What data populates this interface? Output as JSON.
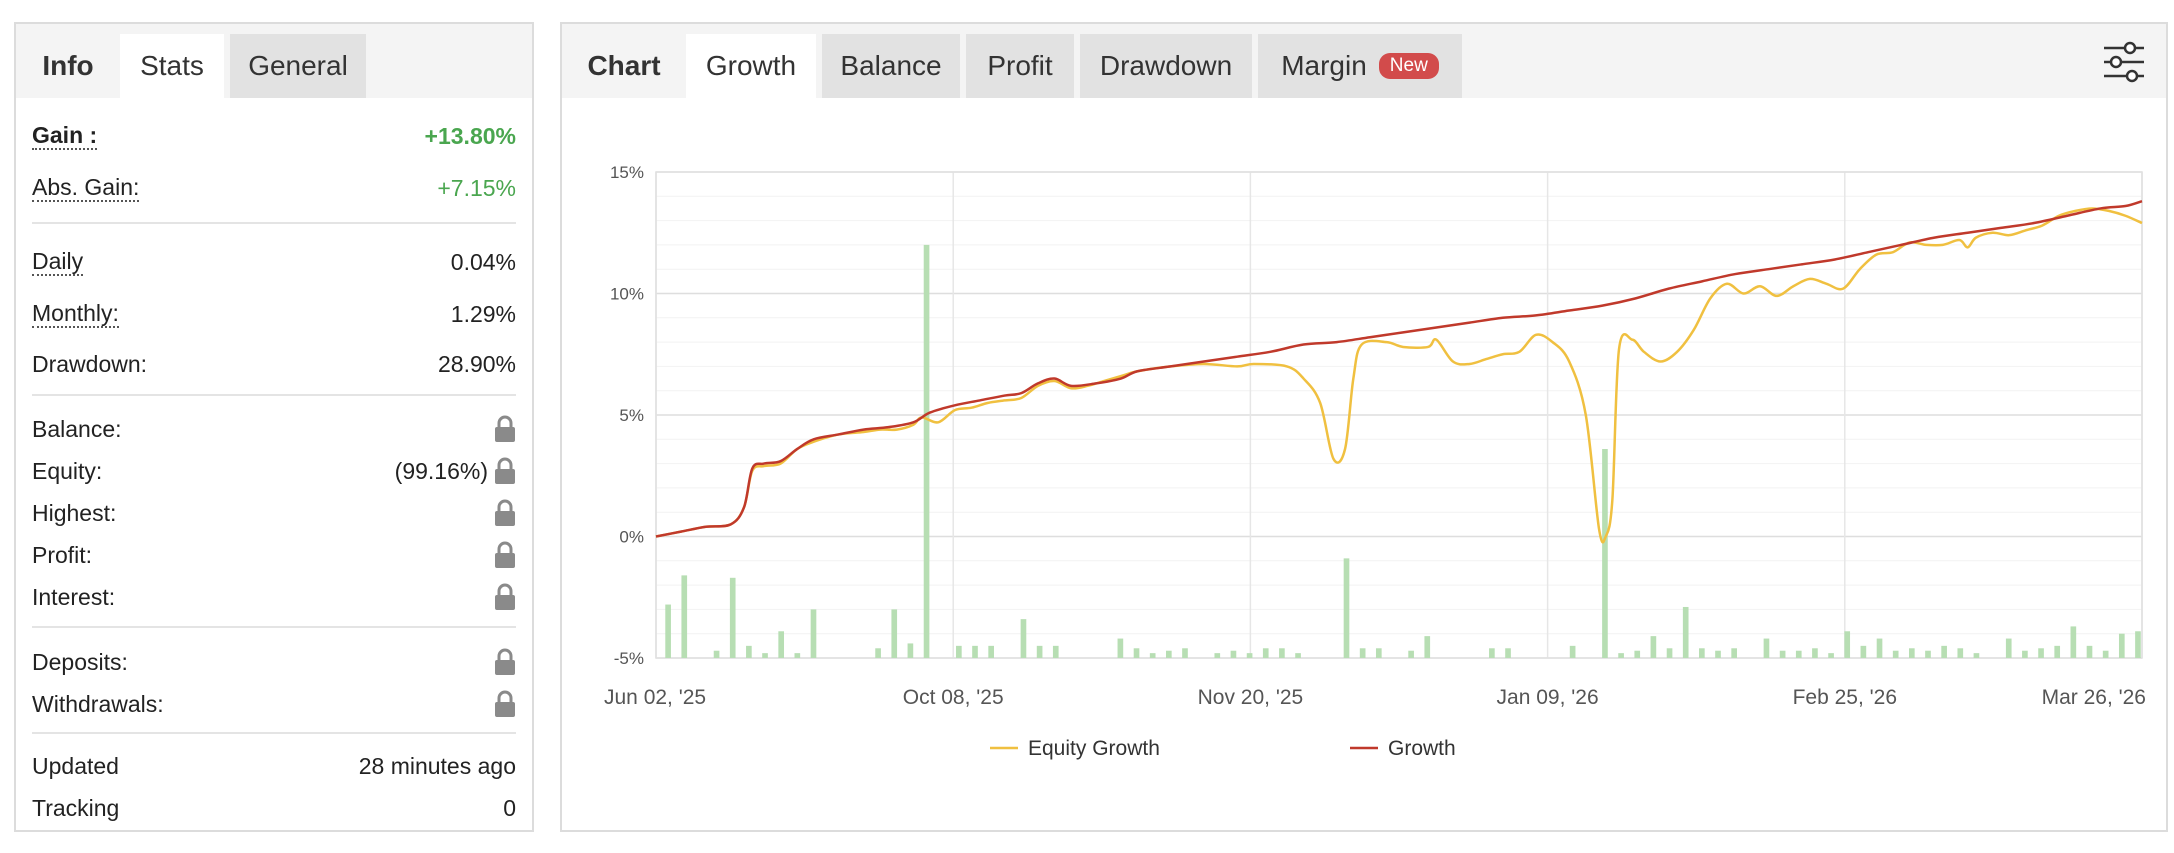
{
  "left_tabs": [
    "Info",
    "Stats",
    "General"
  ],
  "stats": {
    "gain_label": "Gain :",
    "gain_value": "+13.80%",
    "abs_gain_label": "Abs. Gain:",
    "abs_gain_value": "+7.15%",
    "daily_label": "Daily",
    "daily_value": "0.04%",
    "monthly_label": "Monthly:",
    "monthly_value": "1.29%",
    "drawdown_label": "Drawdown:",
    "drawdown_value": "28.90%",
    "balance_label": "Balance:",
    "equity_label": "Equity:",
    "equity_value": "(99.16%)",
    "highest_label": "Highest:",
    "profit_label": "Profit:",
    "interest_label": "Interest:",
    "deposits_label": "Deposits:",
    "withdrawals_label": "Withdrawals:",
    "updated_label": "Updated",
    "updated_value": "28 minutes ago",
    "tracking_label": "Tracking",
    "tracking_value": "0"
  },
  "right_tabs": [
    "Chart",
    "Growth",
    "Balance",
    "Profit",
    "Drawdown",
    "Margin"
  ],
  "margin_badge": "New",
  "icons": {
    "lock": "lock-icon",
    "settings": "sliders-icon"
  },
  "colors": {
    "gain_green": "#4aa64f",
    "equity_line": "#f0c040",
    "growth_line": "#c0392b",
    "bars": "#b7deb3",
    "badge": "#d24b4b"
  },
  "chart_data": {
    "type": "line",
    "y_ticks": [
      "15%",
      "10%",
      "5%",
      "0%",
      "-5%"
    ],
    "ylim": [
      -5,
      15
    ],
    "x_ticks": [
      "Jun 02, '25",
      "Oct 08, '25",
      "Nov 20, '25",
      "Jan 09, '26",
      "Feb 25, '26",
      "Mar 26, '26"
    ],
    "grid": true,
    "legend_position": "bottom",
    "series": [
      {
        "name": "Equity Growth",
        "color": "#f0c040",
        "points": [
          [
            0,
            0
          ],
          [
            1.5,
            0.2
          ],
          [
            3,
            0.4
          ],
          [
            4.5,
            0.5
          ],
          [
            5.3,
            1.2
          ],
          [
            5.8,
            2.7
          ],
          [
            6.5,
            2.9
          ],
          [
            7.5,
            3.0
          ],
          [
            8.5,
            3.6
          ],
          [
            9.5,
            3.9
          ],
          [
            11,
            4.2
          ],
          [
            12.5,
            4.3
          ],
          [
            13.5,
            4.4
          ],
          [
            14.5,
            4.4
          ],
          [
            15.5,
            4.6
          ],
          [
            16,
            4.9
          ],
          [
            17,
            4.7
          ],
          [
            18,
            5.2
          ],
          [
            19,
            5.3
          ],
          [
            20,
            5.5
          ],
          [
            21,
            5.6
          ],
          [
            22,
            5.7
          ],
          [
            23,
            6.2
          ],
          [
            24,
            6.4
          ],
          [
            25,
            6.1
          ],
          [
            26,
            6.2
          ],
          [
            27,
            6.4
          ],
          [
            28,
            6.6
          ],
          [
            29,
            6.8
          ],
          [
            31,
            7.0
          ],
          [
            33,
            7.1
          ],
          [
            35,
            7.0
          ],
          [
            36,
            7.1
          ],
          [
            38,
            7.0
          ],
          [
            39,
            6.5
          ],
          [
            40,
            5.5
          ],
          [
            40.8,
            3.2
          ],
          [
            41.5,
            3.6
          ],
          [
            42,
            6.5
          ],
          [
            42.5,
            7.9
          ],
          [
            44,
            8.0
          ],
          [
            45,
            7.8
          ],
          [
            46.5,
            7.8
          ],
          [
            47,
            8.1
          ],
          [
            48,
            7.2
          ],
          [
            49,
            7.1
          ],
          [
            50,
            7.3
          ],
          [
            51,
            7.5
          ],
          [
            52,
            7.6
          ],
          [
            53,
            8.3
          ],
          [
            54,
            8.0
          ],
          [
            55,
            7.2
          ],
          [
            56,
            5.0
          ],
          [
            56.8,
            0.3
          ],
          [
            57.2,
            0.0
          ],
          [
            57.6,
            1.5
          ],
          [
            58,
            7.7
          ],
          [
            58.8,
            8.1
          ],
          [
            59.5,
            7.6
          ],
          [
            60.5,
            7.2
          ],
          [
            61.5,
            7.6
          ],
          [
            62.5,
            8.5
          ],
          [
            63.5,
            9.8
          ],
          [
            64.5,
            10.4
          ],
          [
            65.5,
            10.0
          ],
          [
            66.5,
            10.3
          ],
          [
            67.5,
            9.9
          ],
          [
            68.5,
            10.3
          ],
          [
            69.5,
            10.6
          ],
          [
            70.5,
            10.4
          ],
          [
            71.5,
            10.2
          ],
          [
            72.5,
            11.0
          ],
          [
            73.5,
            11.6
          ],
          [
            74.5,
            11.7
          ],
          [
            75.5,
            12.1
          ],
          [
            76.5,
            12.0
          ],
          [
            77.5,
            12.0
          ],
          [
            78.5,
            12.2
          ],
          [
            79,
            11.9
          ],
          [
            79.5,
            12.3
          ],
          [
            80.5,
            12.5
          ],
          [
            81.5,
            12.4
          ],
          [
            82.5,
            12.6
          ],
          [
            83.5,
            12.8
          ],
          [
            84.5,
            13.2
          ],
          [
            85.5,
            13.4
          ],
          [
            86.5,
            13.5
          ],
          [
            87.5,
            13.4
          ],
          [
            88.5,
            13.2
          ],
          [
            89.5,
            12.9
          ]
        ]
      },
      {
        "name": "Growth",
        "color": "#c0392b",
        "points": [
          [
            0,
            0
          ],
          [
            1.5,
            0.2
          ],
          [
            3,
            0.4
          ],
          [
            4.5,
            0.5
          ],
          [
            5.3,
            1.2
          ],
          [
            5.8,
            2.8
          ],
          [
            6.5,
            3.0
          ],
          [
            7.5,
            3.1
          ],
          [
            8.5,
            3.6
          ],
          [
            9.5,
            4.0
          ],
          [
            11,
            4.2
          ],
          [
            12.5,
            4.4
          ],
          [
            14,
            4.5
          ],
          [
            15.5,
            4.7
          ],
          [
            16.5,
            5.1
          ],
          [
            18,
            5.4
          ],
          [
            19.5,
            5.6
          ],
          [
            21,
            5.8
          ],
          [
            22,
            5.9
          ],
          [
            23,
            6.3
          ],
          [
            24,
            6.5
          ],
          [
            25,
            6.2
          ],
          [
            26.5,
            6.3
          ],
          [
            28,
            6.5
          ],
          [
            29,
            6.8
          ],
          [
            31,
            7.0
          ],
          [
            33,
            7.2
          ],
          [
            35,
            7.4
          ],
          [
            37,
            7.6
          ],
          [
            39,
            7.9
          ],
          [
            41,
            8.0
          ],
          [
            43,
            8.2
          ],
          [
            45,
            8.4
          ],
          [
            47,
            8.6
          ],
          [
            49,
            8.8
          ],
          [
            51,
            9.0
          ],
          [
            53,
            9.1
          ],
          [
            55,
            9.3
          ],
          [
            57,
            9.5
          ],
          [
            59,
            9.8
          ],
          [
            61,
            10.2
          ],
          [
            63,
            10.5
          ],
          [
            65,
            10.8
          ],
          [
            67,
            11.0
          ],
          [
            69,
            11.2
          ],
          [
            71,
            11.4
          ],
          [
            73,
            11.7
          ],
          [
            75,
            12.0
          ],
          [
            77,
            12.3
          ],
          [
            79,
            12.5
          ],
          [
            81,
            12.7
          ],
          [
            83,
            12.9
          ],
          [
            85,
            13.2
          ],
          [
            87,
            13.5
          ],
          [
            88.5,
            13.6
          ],
          [
            89.5,
            13.8
          ]
        ]
      }
    ],
    "bars": [
      0,
      2.2,
      0,
      3.4,
      0,
      0,
      0,
      0.3,
      0,
      3.3,
      0,
      0.5,
      0,
      0.2,
      0,
      1.1,
      0,
      0.2,
      0,
      2.0,
      0,
      0,
      0,
      0,
      0,
      0,
      0,
      0.4,
      0,
      2.0,
      0,
      0.6,
      0,
      17.0,
      0,
      0,
      0,
      0.5,
      0,
      0.5,
      0,
      0.5,
      0,
      0,
      0,
      1.6,
      0,
      0.5,
      0,
      0.5,
      0,
      0,
      0,
      0,
      0,
      0,
      0,
      0.8,
      0,
      0.4,
      0,
      0.2,
      0,
      0.3,
      0,
      0.4,
      0,
      0,
      0,
      0.2,
      0,
      0.3,
      0,
      0.2,
      0,
      0.4,
      0,
      0.4,
      0,
      0.2,
      0,
      0,
      0,
      0,
      0,
      4.1,
      0,
      0.4,
      0,
      0.4,
      0,
      0,
      0,
      0.3,
      0,
      0.9,
      0,
      0,
      0,
      0,
      0,
      0,
      0,
      0.4,
      0,
      0.4,
      0,
      0,
      0,
      0,
      0,
      0,
      0,
      0.5,
      0,
      0,
      0,
      8.6,
      0,
      0.2,
      0,
      0.3,
      0,
      0.9,
      0,
      0.4,
      0,
      2.1,
      0,
      0.4,
      0,
      0.3,
      0,
      0.4,
      0,
      0,
      0,
      0.8,
      0,
      0.3,
      0,
      0.3,
      0,
      0.4,
      0,
      0.2,
      0,
      1.1,
      0,
      0.5,
      0,
      0.8,
      0,
      0.3,
      0,
      0.4,
      0,
      0.3,
      0,
      0.5,
      0,
      0.4,
      0,
      0.2,
      0,
      0,
      0,
      0.8,
      0,
      0.3,
      0,
      0.4,
      0,
      0.5,
      0,
      1.3,
      0,
      0.5,
      0,
      0.3,
      0,
      1.0,
      0,
      1.1
    ],
    "bar_color": "#b7deb3"
  }
}
